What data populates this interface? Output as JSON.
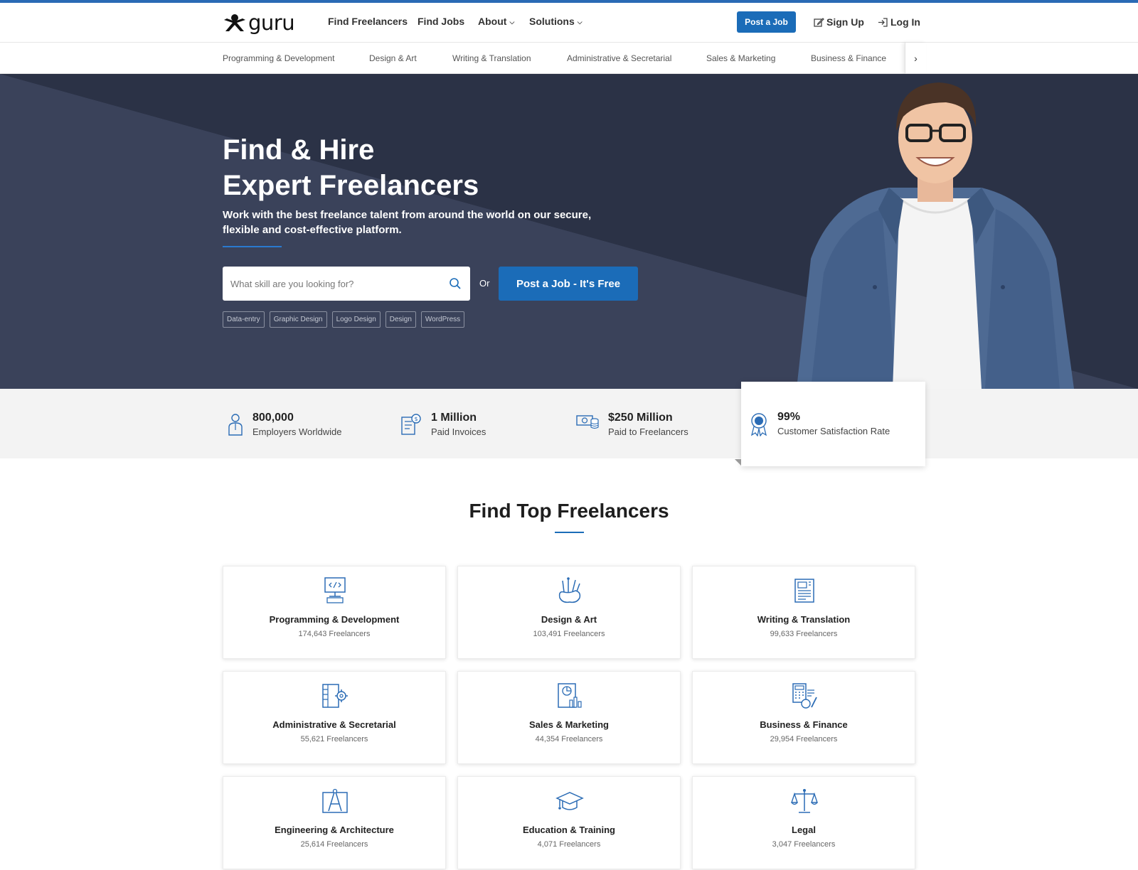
{
  "header": {
    "logo_text": "guru",
    "nav": [
      {
        "label": "Find Freelancers",
        "dropdown": false
      },
      {
        "label": "Find Jobs",
        "dropdown": false
      },
      {
        "label": "About",
        "dropdown": true
      },
      {
        "label": "Solutions",
        "dropdown": true
      }
    ],
    "post_job": "Post a Job",
    "sign_up": "Sign Up",
    "log_in": "Log In"
  },
  "category_bar": {
    "items": [
      "Programming & Development",
      "Design & Art",
      "Writing & Translation",
      "Administrative & Secretarial",
      "Sales & Marketing",
      "Business & Finance"
    ],
    "next_arrow": "›"
  },
  "hero": {
    "title_line1": "Find & Hire",
    "title_line2": "Expert Freelancers",
    "subtitle": "Work with the best freelance talent from around the world on our secure, flexible and cost-effective platform.",
    "search_placeholder": "What skill are you looking for?",
    "or_label": "Or",
    "post_button": "Post a Job - It's Free",
    "tags": [
      "Data-entry",
      "Graphic Design",
      "Logo Design",
      "Design",
      "WordPress"
    ]
  },
  "stats": [
    {
      "value": "800,000",
      "label": "Employers Worldwide",
      "icon": "employer-icon"
    },
    {
      "value": "1 Million",
      "label": "Paid Invoices",
      "icon": "invoice-icon"
    },
    {
      "value": "$250 Million",
      "label": "Paid to Freelancers",
      "icon": "money-icon"
    },
    {
      "value": "99%",
      "label": "Customer Satisfaction Rate",
      "icon": "award-icon"
    }
  ],
  "section": {
    "title": "Find Top Freelancers"
  },
  "categories": [
    {
      "title": "Programming & Development",
      "count": "174,643 Freelancers",
      "icon": "code-monitor-icon"
    },
    {
      "title": "Design & Art",
      "count": "103,491 Freelancers",
      "icon": "brushes-icon"
    },
    {
      "title": "Writing & Translation",
      "count": "99,633 Freelancers",
      "icon": "document-icon"
    },
    {
      "title": "Administrative & Secretarial",
      "count": "55,621 Freelancers",
      "icon": "binder-gear-icon"
    },
    {
      "title": "Sales & Marketing",
      "count": "44,354 Freelancers",
      "icon": "chart-report-icon"
    },
    {
      "title": "Business & Finance",
      "count": "29,954 Freelancers",
      "icon": "calculator-icon"
    },
    {
      "title": "Engineering & Architecture",
      "count": "25,614 Freelancers",
      "icon": "compass-blueprint-icon"
    },
    {
      "title": "Education & Training",
      "count": "4,071 Freelancers",
      "icon": "graduation-cap-icon"
    },
    {
      "title": "Legal",
      "count": "3,047 Freelancers",
      "icon": "scales-icon"
    }
  ],
  "colors": {
    "brand_blue": "#1b6cb8",
    "hero_dark": "#2b3246",
    "icon_blue": "#2b6cb5"
  }
}
